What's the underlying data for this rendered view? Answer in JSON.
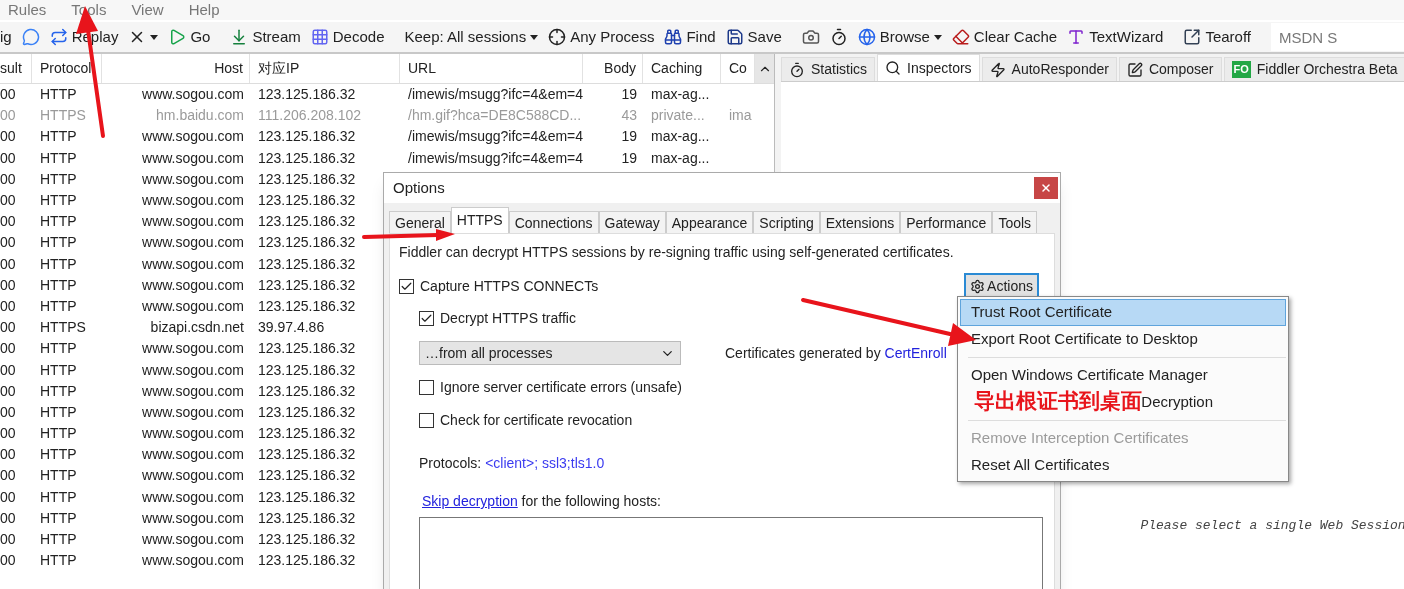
{
  "menu_bar": [
    {
      "label": "Rules"
    },
    {
      "label": "Tools"
    },
    {
      "label": "View"
    },
    {
      "label": "Help"
    }
  ],
  "toolbar": [
    {
      "kind": "button",
      "label": "ig"
    },
    {
      "kind": "icon"
    },
    {
      "kind": "button",
      "label": "Replay"
    },
    {
      "kind": "icon",
      "dropdown": true
    },
    {
      "kind": "button",
      "label": "Go"
    },
    {
      "kind": "separator"
    },
    {
      "kind": "button",
      "label": "Stream"
    },
    {
      "kind": "button",
      "label": "Decode"
    },
    {
      "kind": "separator"
    },
    {
      "kind": "button",
      "label": "Keep: All sessions",
      "dropdown": true
    },
    {
      "kind": "button",
      "label": "Any Process"
    },
    {
      "kind": "button",
      "label": "Find"
    },
    {
      "kind": "button",
      "label": "Save"
    },
    {
      "kind": "separator"
    },
    {
      "kind": "icon"
    },
    {
      "kind": "icon"
    },
    {
      "kind": "button",
      "label": "Browse",
      "dropdown": true
    },
    {
      "kind": "button",
      "label": "Clear Cache"
    },
    {
      "kind": "button",
      "label": "TextWizard"
    },
    {
      "kind": "separator"
    },
    {
      "kind": "button",
      "label": "Tearoff"
    },
    {
      "kind": "separator"
    },
    {
      "kind": "field",
      "placeholder": "MSDN S"
    }
  ],
  "sessions": {
    "columns": [
      "sult",
      "Protocol",
      "Host",
      "对应IP",
      "URL",
      "Body",
      "Caching",
      "Co"
    ],
    "rows": [
      {
        "dimmed": false,
        "cells": [
          "00",
          "HTTP",
          "www.sogou.com",
          "123.125.186.32",
          "/imewis/msugg?ifc=4&em=4",
          "19",
          "max-ag..."
        ]
      },
      {
        "dimmed": true,
        "cells": [
          "00",
          "HTTPS",
          "hm.baidu.com",
          "111.206.208.102",
          "/hm.gif?hca=DE8C588CD...",
          "43",
          "private...",
          "ima"
        ]
      },
      {
        "dimmed": false,
        "cells": [
          "00",
          "HTTP",
          "www.sogou.com",
          "123.125.186.32",
          "/imewis/msugg?ifc=4&em=4",
          "19",
          "max-ag..."
        ]
      },
      {
        "dimmed": false,
        "cells": [
          "00",
          "HTTP",
          "www.sogou.com",
          "123.125.186.32",
          "/imewis/msugg?ifc=4&em=4",
          "19",
          "max-ag..."
        ]
      },
      {
        "dimmed": false,
        "cells": [
          "00",
          "HTTP",
          "www.sogou.com",
          "123.125.186.32"
        ]
      },
      {
        "dimmed": false,
        "cells": [
          "00",
          "HTTP",
          "www.sogou.com",
          "123.125.186.32"
        ]
      },
      {
        "dimmed": false,
        "cells": [
          "00",
          "HTTP",
          "www.sogou.com",
          "123.125.186.32"
        ]
      },
      {
        "dimmed": false,
        "cells": [
          "00",
          "HTTP",
          "www.sogou.com",
          "123.125.186.32"
        ]
      },
      {
        "dimmed": false,
        "cells": [
          "00",
          "HTTP",
          "www.sogou.com",
          "123.125.186.32"
        ]
      },
      {
        "dimmed": false,
        "cells": [
          "00",
          "HTTP",
          "www.sogou.com",
          "123.125.186.32"
        ]
      },
      {
        "dimmed": false,
        "cells": [
          "00",
          "HTTP",
          "www.sogou.com",
          "123.125.186.32"
        ]
      },
      {
        "dimmed": false,
        "cells": [
          "00",
          "HTTPS",
          "bizapi.csdn.net",
          "39.97.4.86"
        ]
      },
      {
        "dimmed": false,
        "cells": [
          "00",
          "HTTP",
          "www.sogou.com",
          "123.125.186.32"
        ]
      },
      {
        "dimmed": false,
        "cells": [
          "00",
          "HTTP",
          "www.sogou.com",
          "123.125.186.32"
        ]
      },
      {
        "dimmed": false,
        "cells": [
          "00",
          "HTTP",
          "www.sogou.com",
          "123.125.186.32"
        ]
      },
      {
        "dimmed": false,
        "cells": [
          "00",
          "HTTP",
          "www.sogou.com",
          "123.125.186.32"
        ]
      },
      {
        "dimmed": false,
        "cells": [
          "00",
          "HTTP",
          "www.sogou.com",
          "123.125.186.32"
        ]
      },
      {
        "dimmed": false,
        "cells": [
          "00",
          "HTTP",
          "www.sogou.com",
          "123.125.186.32"
        ]
      },
      {
        "dimmed": false,
        "cells": [
          "00",
          "HTTP",
          "www.sogou.com",
          "123.125.186.32"
        ]
      },
      {
        "dimmed": false,
        "cells": [
          "00",
          "HTTP",
          "www.sogou.com",
          "123.125.186.32"
        ]
      },
      {
        "dimmed": false,
        "cells": [
          "00",
          "HTTP",
          "www.sogou.com",
          "123.125.186.32"
        ]
      },
      {
        "dimmed": false,
        "cells": [
          "00",
          "HTTP",
          "www.sogou.com",
          "123.125.186.32"
        ]
      },
      {
        "dimmed": false,
        "cells": [
          "00",
          "HTTP",
          "www.sogou.com",
          "123.125.186.32"
        ]
      }
    ]
  },
  "inspector_tabs": [
    {
      "label": "Statistics",
      "selected": false
    },
    {
      "label": "Inspectors",
      "selected": true
    },
    {
      "label": "AutoResponder",
      "selected": false
    },
    {
      "label": "Composer",
      "selected": false
    },
    {
      "label": "Fiddler Orchestra Beta",
      "badge": "FO",
      "selected": false
    }
  ],
  "inspector_message": "Please select a single Web Session",
  "dialog": {
    "title": "Options",
    "tabs": [
      {
        "label": "General",
        "selected": false
      },
      {
        "label": "HTTPS",
        "selected": true
      },
      {
        "label": "Connections",
        "selected": false
      },
      {
        "label": "Gateway",
        "selected": false
      },
      {
        "label": "Appearance",
        "selected": false
      },
      {
        "label": "Scripting",
        "selected": false
      },
      {
        "label": "Extensions",
        "selected": false
      },
      {
        "label": "Performance",
        "selected": false
      },
      {
        "label": "Tools",
        "selected": false
      }
    ],
    "description": "Fiddler can decrypt HTTPS sessions by re-signing traffic using self-generated certificates.",
    "capture": {
      "label": "Capture HTTPS CONNECTs",
      "checked": true,
      "children": [
        {
          "kind": "checkbox",
          "label": "Decrypt HTTPS traffic",
          "checked": true
        },
        {
          "kind": "select",
          "value": "…from all processes"
        },
        {
          "kind": "checkbox",
          "label": "Ignore server certificate errors (unsafe)",
          "checked": false
        },
        {
          "kind": "checkbox",
          "label": "Check for certificate revocation",
          "checked": false
        }
      ]
    },
    "cert_note": {
      "text": "Certificates generated by",
      "link": "CertEnroll"
    },
    "actions_button": "Actions",
    "protocols": {
      "label": "Protocols:",
      "value": "<client>; ssl3;tls1.0"
    },
    "skip": {
      "link": "Skip decryption",
      "text": "for the following hosts:"
    }
  },
  "actions_menu": [
    {
      "kind": "item",
      "label": "Trust Root Certificate",
      "selected": true,
      "disabled": false
    },
    {
      "kind": "item",
      "label": "Export Root Certificate to Desktop",
      "selected": false,
      "disabled": false
    },
    {
      "kind": "separator"
    },
    {
      "kind": "item",
      "label": "Open Windows Certificate Manager",
      "selected": false,
      "disabled": false
    },
    {
      "kind": "covered",
      "label": "Decryption",
      "selected": false,
      "disabled": false
    },
    {
      "kind": "separator"
    },
    {
      "kind": "item",
      "label": "Remove Interception Certificates",
      "selected": false,
      "disabled": true
    },
    {
      "kind": "item",
      "label": "Reset All Certificates",
      "selected": false,
      "disabled": false
    }
  ],
  "annotation": {
    "text": "导出根证书到桌面"
  }
}
